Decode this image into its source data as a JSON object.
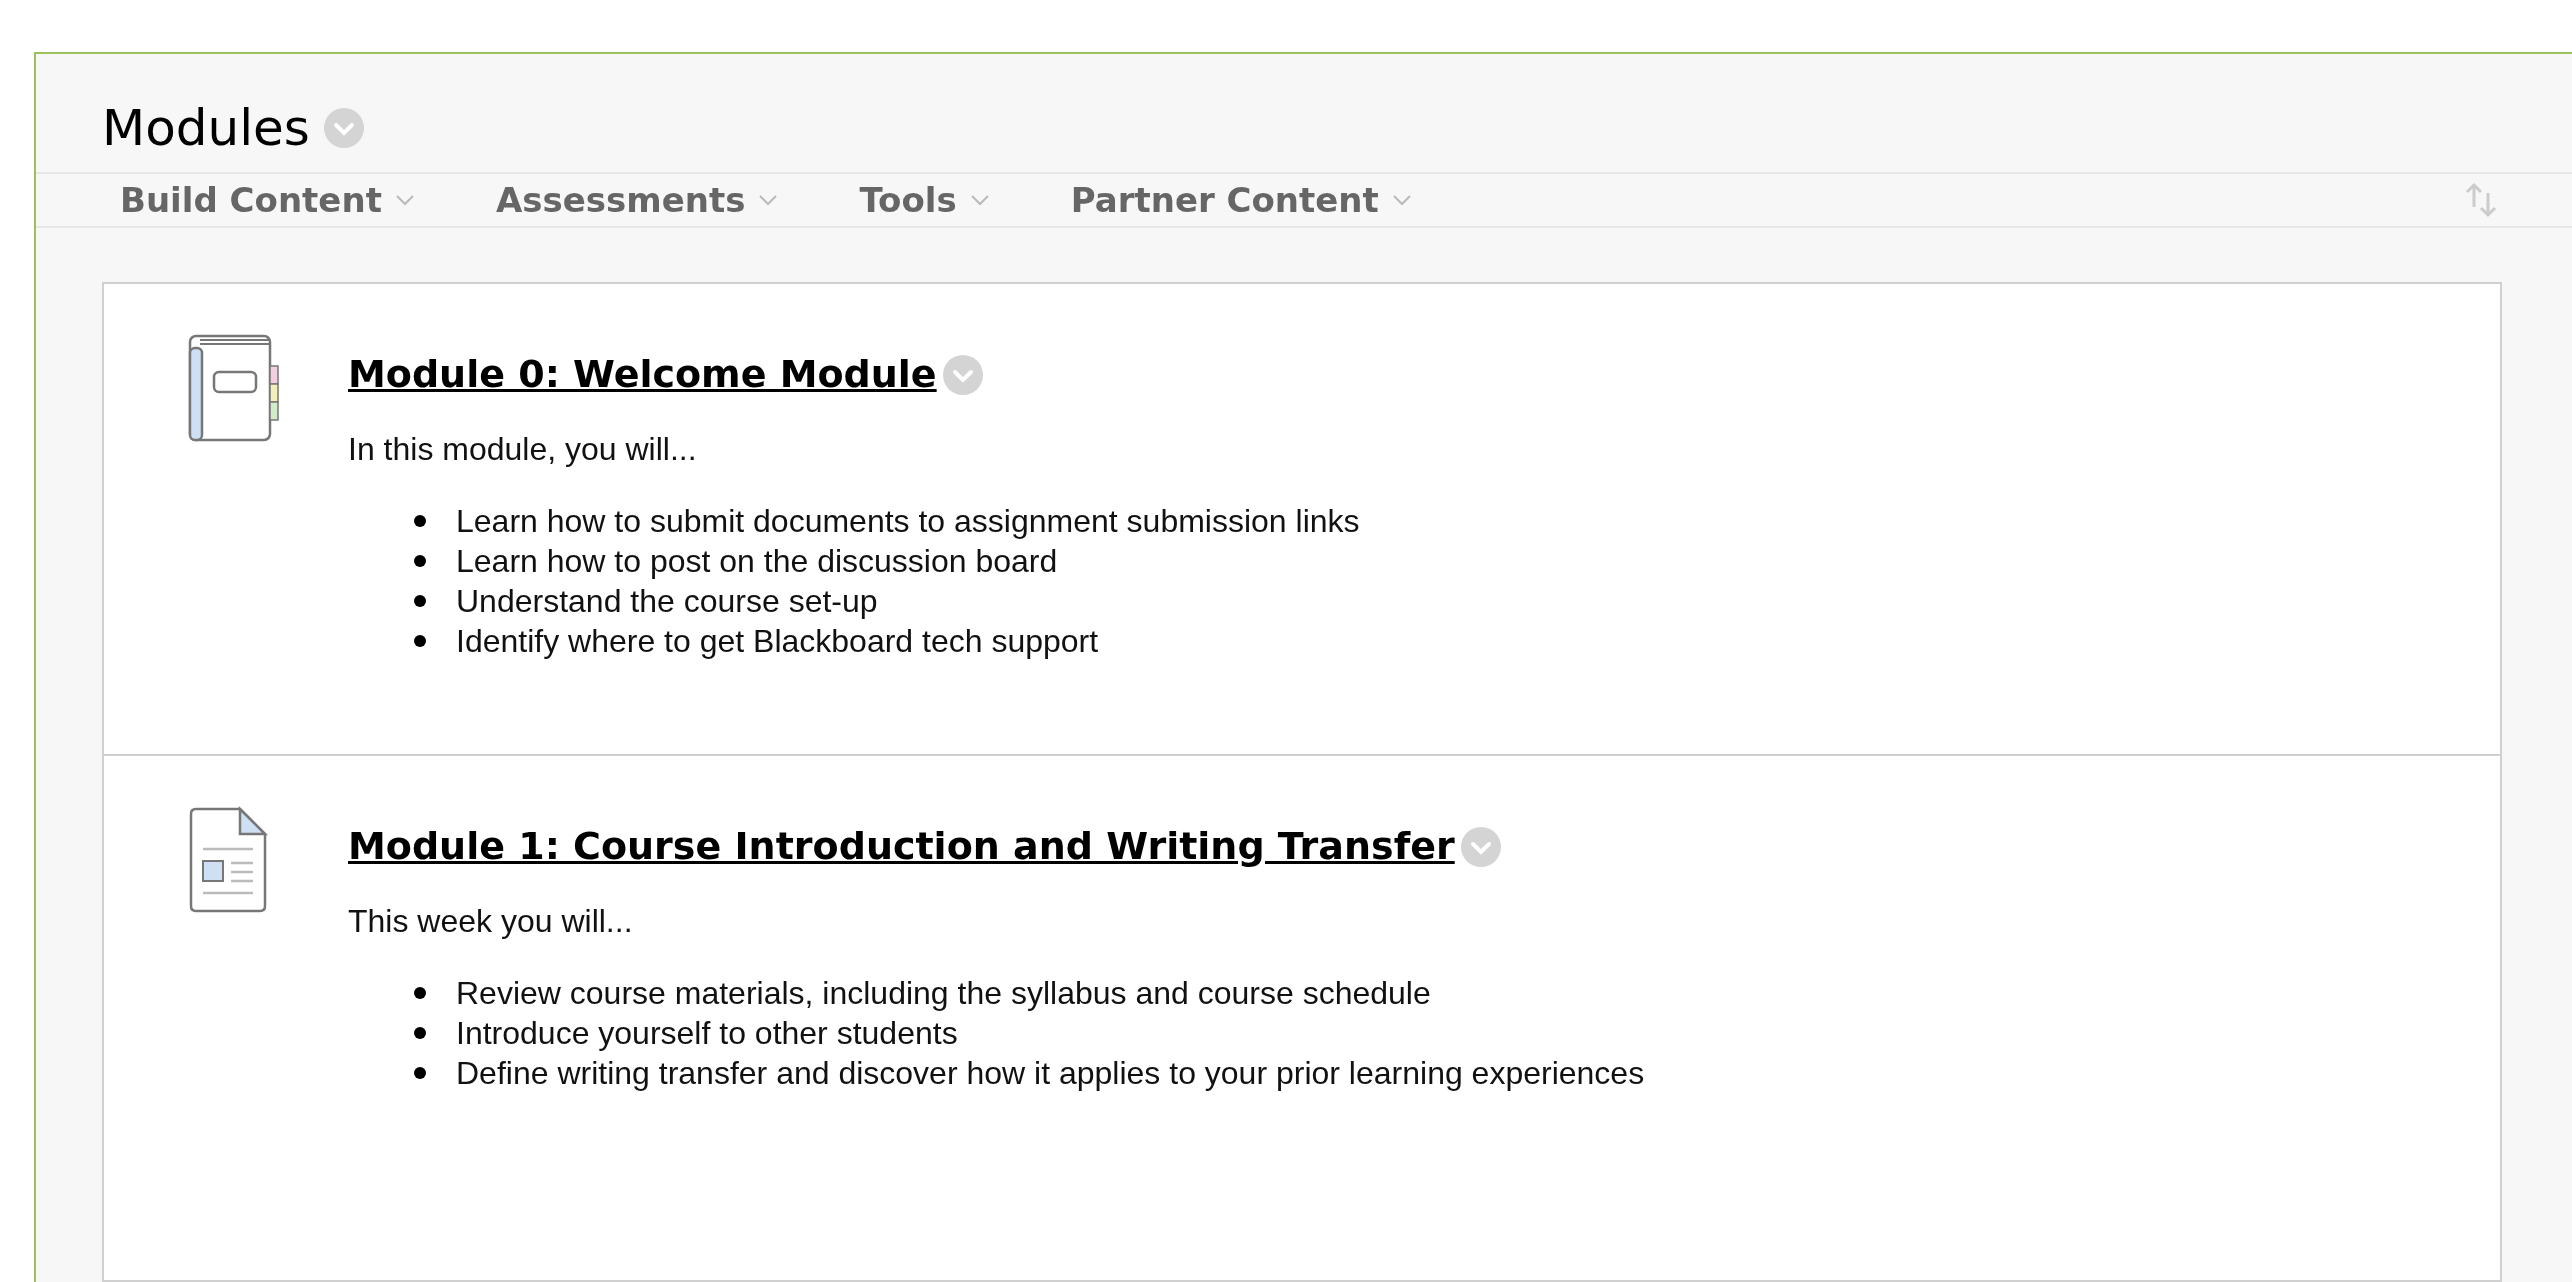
{
  "page": {
    "title": "Modules"
  },
  "toolbar": [
    {
      "label": "Build Content"
    },
    {
      "label": "Assessments"
    },
    {
      "label": "Tools"
    },
    {
      "label": "Partner Content"
    }
  ],
  "modules": [
    {
      "kind": "book",
      "title": "Module 0: Welcome Module",
      "intro": "In this module, you will...",
      "bullets": [
        "Learn how to submit documents to assignment submission links",
        "Learn how to post on the discussion board",
        "Understand the course set-up",
        "Identify where to get Blackboard tech support"
      ]
    },
    {
      "kind": "document",
      "title": "Module 1: Course Introduction and Writing Transfer",
      "intro": "This week you will...",
      "bullets": [
        "Review course materials, including the syllabus and course schedule",
        "Introduce yourself to other students",
        "Define writing transfer and discover how it applies to your prior learning experiences"
      ]
    }
  ]
}
